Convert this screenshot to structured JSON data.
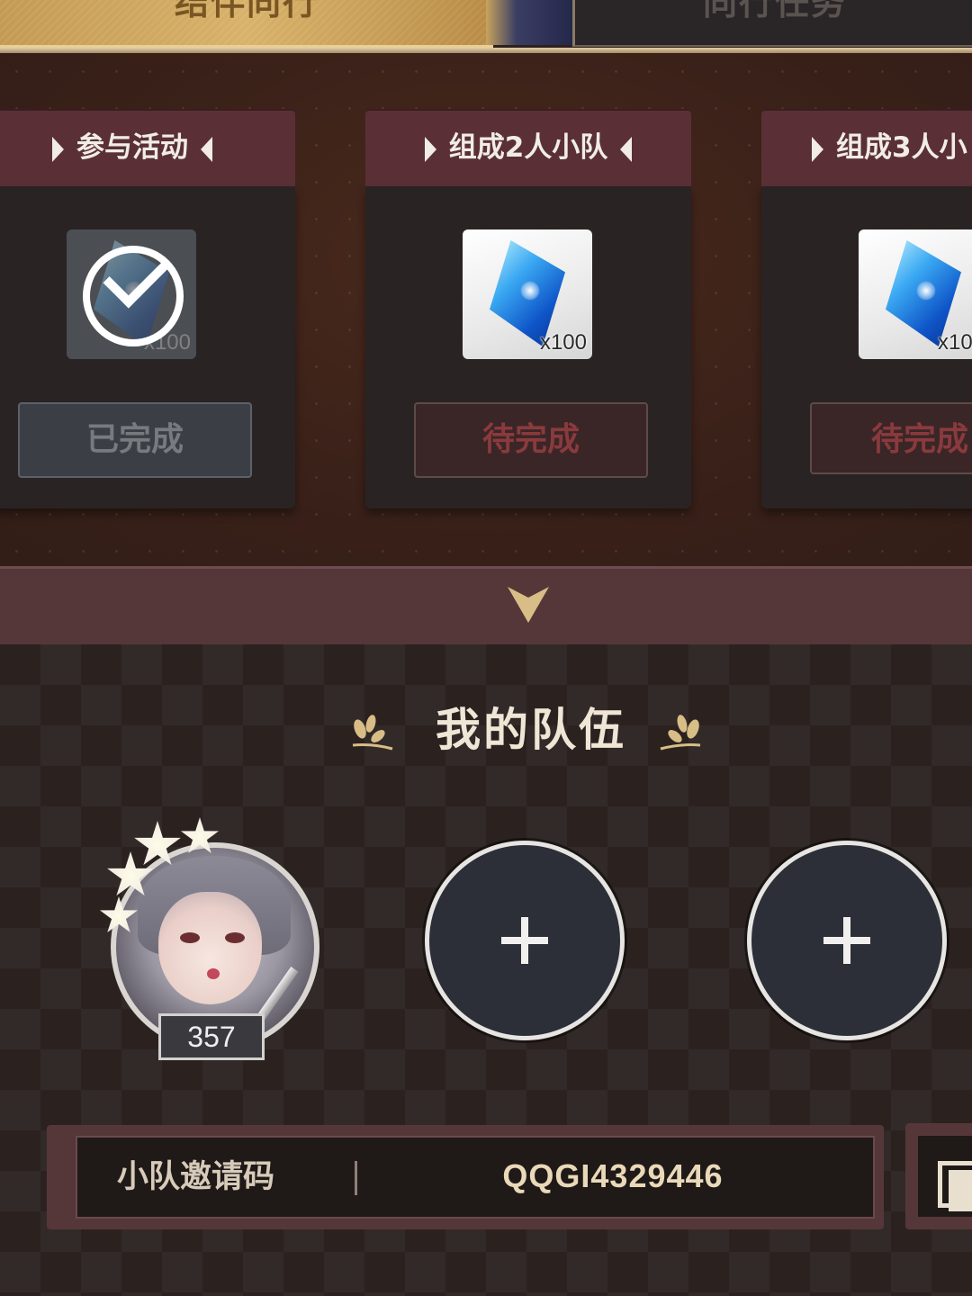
{
  "tabs": {
    "left_label": "结伴同行",
    "right_label": "同行任务"
  },
  "tasks": [
    {
      "title": "参与活动",
      "reward_qty": "x100",
      "status": "已完成",
      "completed": true
    },
    {
      "title": "组成2人小队",
      "reward_qty": "x100",
      "status": "待完成",
      "completed": false
    },
    {
      "title": "组成3人小",
      "reward_qty": "x10",
      "status": "待完成",
      "completed": false
    }
  ],
  "team": {
    "title": "我的队伍",
    "member_level": "357",
    "empty_slots": 2
  },
  "invite": {
    "label": "小队邀请码",
    "code": "QQGI4329446"
  },
  "colors": {
    "accent_gold": "#d8bd86",
    "panel_maroon": "#55373a",
    "pending_text": "#8a3a3d"
  },
  "icons": [
    "check-icon",
    "crystal-icon",
    "collapse-arrow-icon",
    "laurel-icon",
    "plus-icon",
    "copy-icon"
  ]
}
